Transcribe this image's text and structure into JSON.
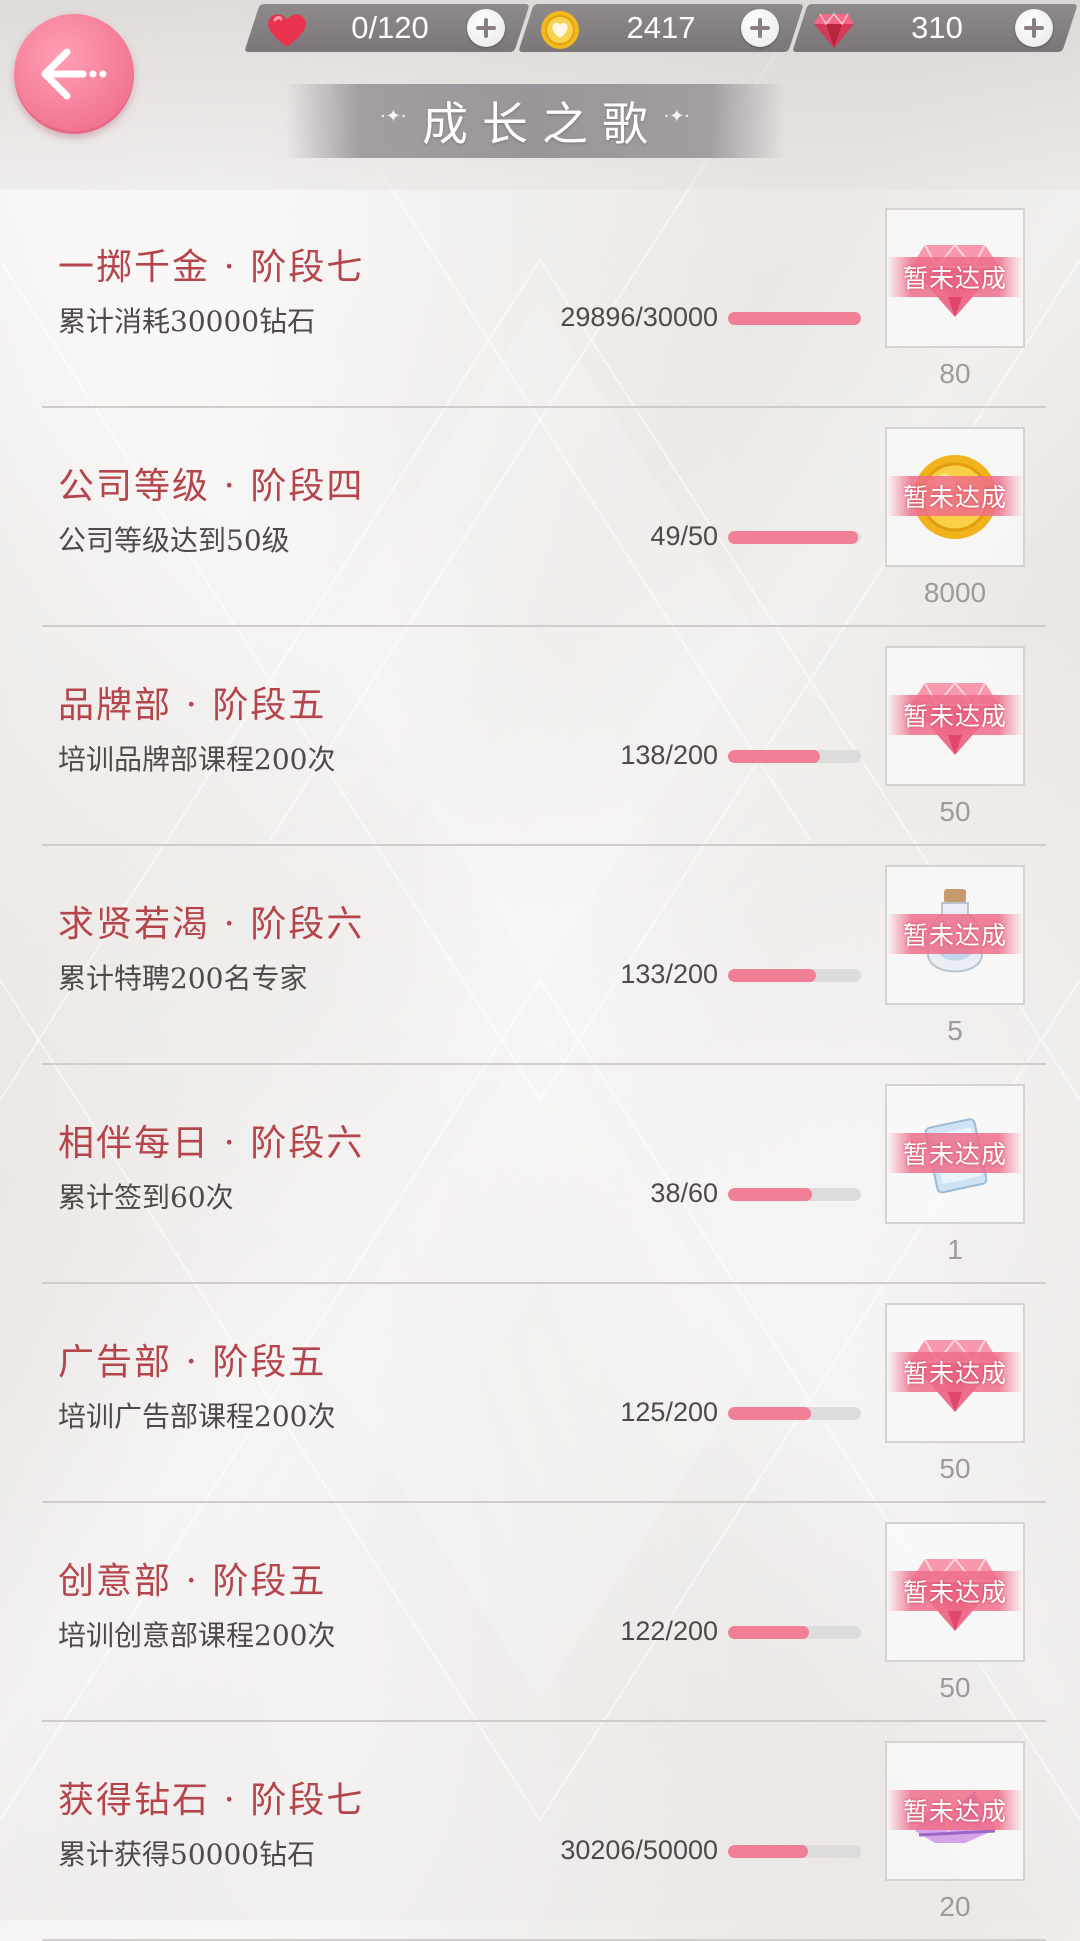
{
  "header": {
    "title": "成长之歌",
    "resources": [
      {
        "name": "hearts",
        "icon": "heart-icon",
        "value": "0/120",
        "color": "#e5334d"
      },
      {
        "name": "coins",
        "icon": "coin-icon",
        "value": "2417",
        "color": "#f2c12e"
      },
      {
        "name": "diamonds",
        "icon": "diamond-icon",
        "value": "310",
        "color": "#d9415e"
      }
    ]
  },
  "status_label": "暂未达成",
  "achievements": [
    {
      "title": "一掷千金 · 阶段七",
      "desc": "累计消耗30000钻石",
      "progress_text": "29896/30000",
      "progress": 0.997,
      "reward_icon": "diamond-icon",
      "reward_count": "80"
    },
    {
      "title": "公司等级 · 阶段四",
      "desc": "公司等级达到50级",
      "progress_text": "49/50",
      "progress": 0.98,
      "reward_icon": "coin-icon",
      "reward_count": "8000"
    },
    {
      "title": "品牌部 · 阶段五",
      "desc": "培训品牌部课程200次",
      "progress_text": "138/200",
      "progress": 0.69,
      "reward_icon": "diamond-icon",
      "reward_count": "50"
    },
    {
      "title": "求贤若渴 · 阶段六",
      "desc": "累计特聘200名专家",
      "progress_text": "133/200",
      "progress": 0.665,
      "reward_icon": "bottle-icon",
      "reward_count": "5"
    },
    {
      "title": "相伴每日 · 阶段六",
      "desc": "累计签到60次",
      "progress_text": "38/60",
      "progress": 0.633,
      "reward_icon": "card-icon",
      "reward_count": "1"
    },
    {
      "title": "广告部 · 阶段五",
      "desc": "培训广告部课程200次",
      "progress_text": "125/200",
      "progress": 0.625,
      "reward_icon": "diamond-icon",
      "reward_count": "50"
    },
    {
      "title": "创意部 · 阶段五",
      "desc": "培训创意部课程200次",
      "progress_text": "122/200",
      "progress": 0.61,
      "reward_icon": "diamond-icon",
      "reward_count": "50"
    },
    {
      "title": "获得钻石 · 阶段七",
      "desc": "累计获得50000钻石",
      "progress_text": "30206/50000",
      "progress": 0.604,
      "reward_icon": "crystal-icon",
      "reward_count": "20"
    }
  ]
}
